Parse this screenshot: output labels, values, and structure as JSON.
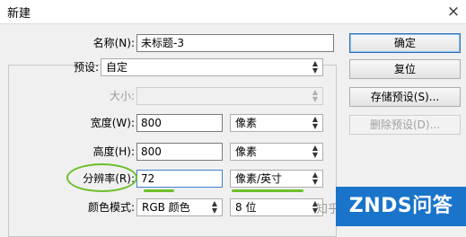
{
  "window": {
    "title": "新建",
    "close_glyph": "×"
  },
  "form": {
    "name_label": "名称(N):",
    "name_value": "未标题-3",
    "preset_label": "预设:",
    "preset_value": "自定",
    "size_label": "大小:",
    "size_value": "",
    "width_label": "宽度(W):",
    "width_value": "800",
    "width_unit": "像素",
    "height_label": "高度(H):",
    "height_value": "800",
    "height_unit": "像素",
    "resolution_label": "分辨率(R):",
    "resolution_value": "72",
    "resolution_unit": "像素/英寸",
    "color_mode_label": "颜色模式:",
    "color_mode_value": "RGB 颜色",
    "bit_depth_value": "8 位"
  },
  "buttons": {
    "ok": "确定",
    "reset": "复位",
    "save_preset": "存储预设(S)...",
    "delete_preset": "删除预设(D)..."
  },
  "watermark": {
    "zhihu": "知乎",
    "brand": "ZNDS问答"
  },
  "colors": {
    "annotation_green": "#6cc02a",
    "focus_blue": "#3c7fd0",
    "watermark_blue": "#1a74c9"
  },
  "icons": {
    "dropdown": "triangle-down"
  }
}
